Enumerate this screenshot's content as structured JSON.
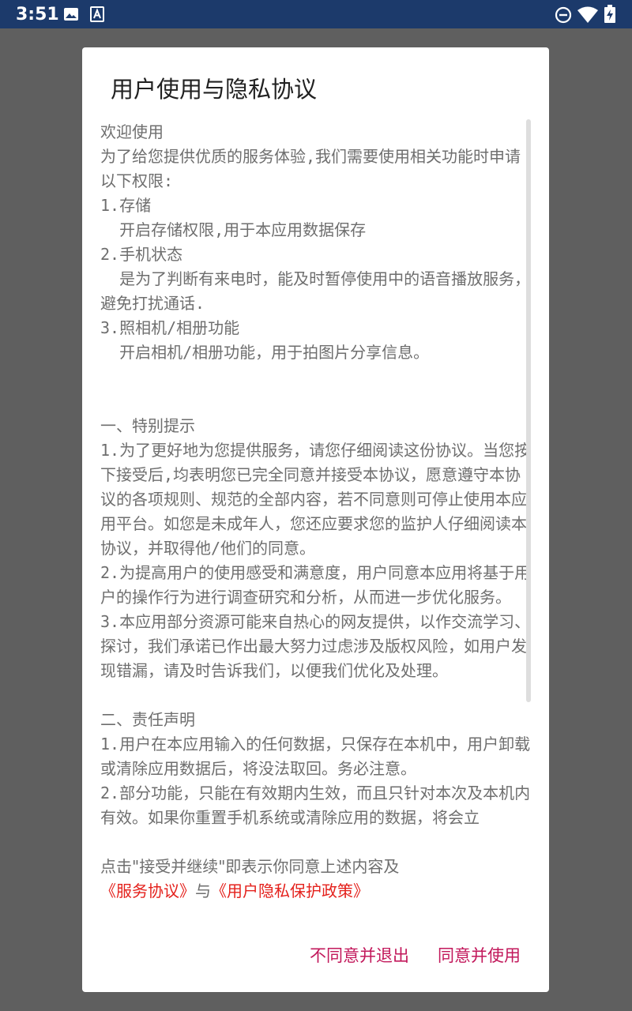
{
  "status_bar": {
    "time": "3:51",
    "left_icons": [
      "image-icon",
      "a-text-icon"
    ],
    "right_icons": [
      "dnd-icon",
      "wifi-icon",
      "battery-charging-icon"
    ]
  },
  "dialog": {
    "title": "用户使用与隐私协议",
    "content": "欢迎使用\n为了给您提供优质的服务体验,我们需要使用相关功能时申请以下权限:\n1.存储\n  开启存储权限,用于本应用数据保存\n2.手机状态\n  是为了判断有来电时，能及时暂停使用中的语音播放服务，避免打扰通话.\n3.照相机/相册功能\n  开启相机/相册功能，用于拍图片分享信息。\n\n\n一、特别提示\n1.为了更好地为您提供服务，请您仔细阅读这份协议。当您按下接受后,均表明您已完全同意并接受本协议，愿意遵守本协议的各项规则、规范的全部内容，若不同意则可停止使用本应用平台。如您是未成年人，您还应要求您的监护人仔细阅读本协议，并取得他/他们的同意。\n2.为提高用户的使用感受和满意度，用户同意本应用将基于用户的操作行为进行调查研究和分析，从而进一步优化服务。\n3.本应用部分资源可能来自热心的网友提供，以作交流学习、探讨，我们承诺已作出最大努力过虑涉及版权风险，如用户发现错漏，请及时告诉我们，以便我们优化及处理。\n\n二、责任声明\n1.用户在本应用输入的任何数据，只保存在本机中，用户卸载或清除应用数据后，将没法取回。务必注意。\n2.部分功能，只能在有效期内生效，而且只针对本次及本机内有效。如果你重置手机系统或清除应用的数据，将会立",
    "consent_text": "点击\"接受并继续\"即表示你同意上述内容及",
    "link_service": "《服务协议》",
    "link_connector": "与",
    "link_privacy": "《用户隐私保护政策》",
    "buttons": {
      "disagree": "不同意并退出",
      "agree": "同意并使用"
    }
  },
  "colors": {
    "status_bar": "#1c3a6b",
    "scrim": "#5f5f5f",
    "body_text": "#6e6e6e",
    "link": "#e4211c",
    "button": "#c2185b"
  }
}
